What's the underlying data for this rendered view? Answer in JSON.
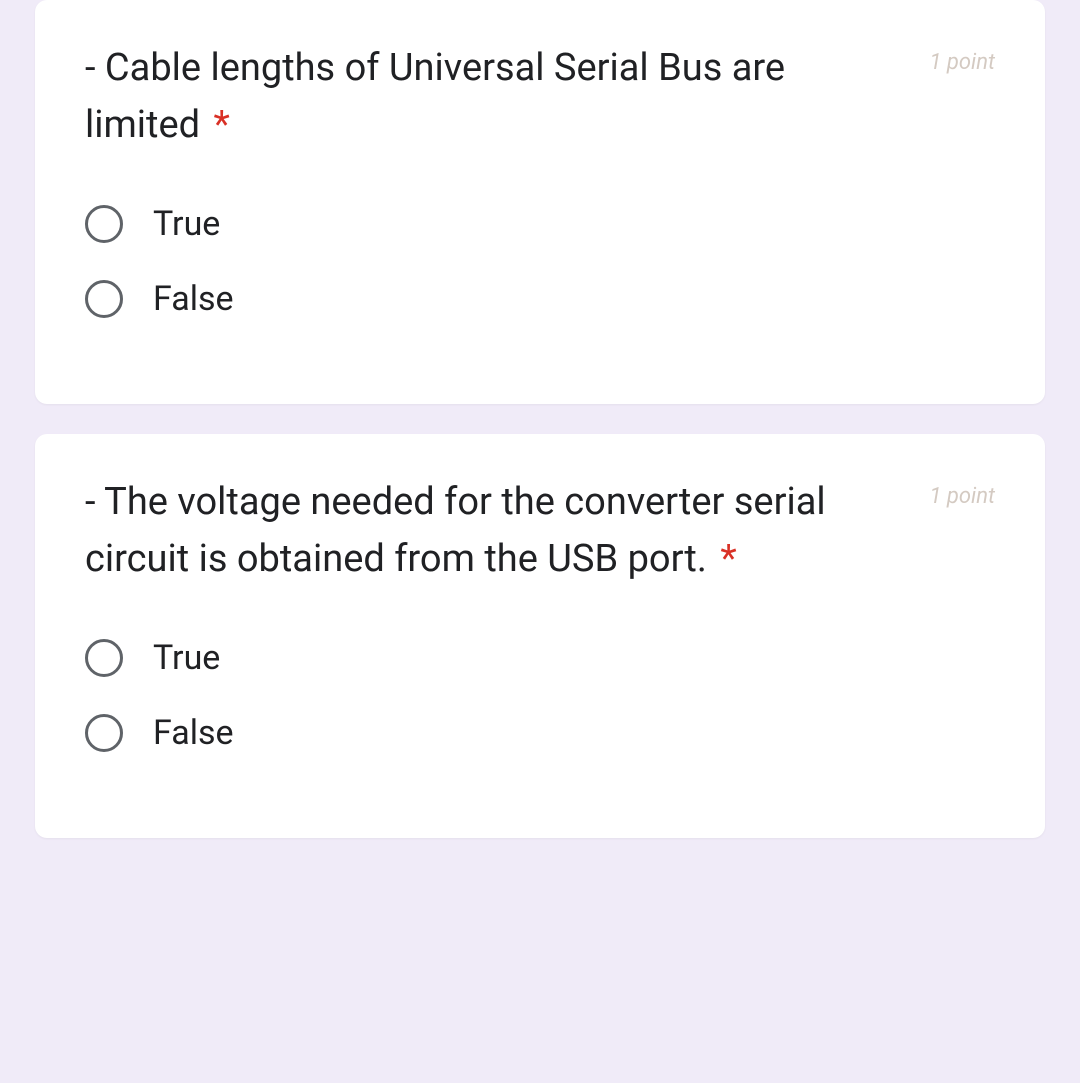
{
  "questions": [
    {
      "text": "- Cable lengths of Universal Serial Bus are limited",
      "required_marker": "*",
      "points": "1 point",
      "options": [
        {
          "label": "True"
        },
        {
          "label": "False"
        }
      ]
    },
    {
      "text": "- The voltage needed for the converter serial circuit is obtained from the USB port.",
      "required_marker": "*",
      "points": "1 point",
      "options": [
        {
          "label": "True"
        },
        {
          "label": "False"
        }
      ]
    }
  ]
}
